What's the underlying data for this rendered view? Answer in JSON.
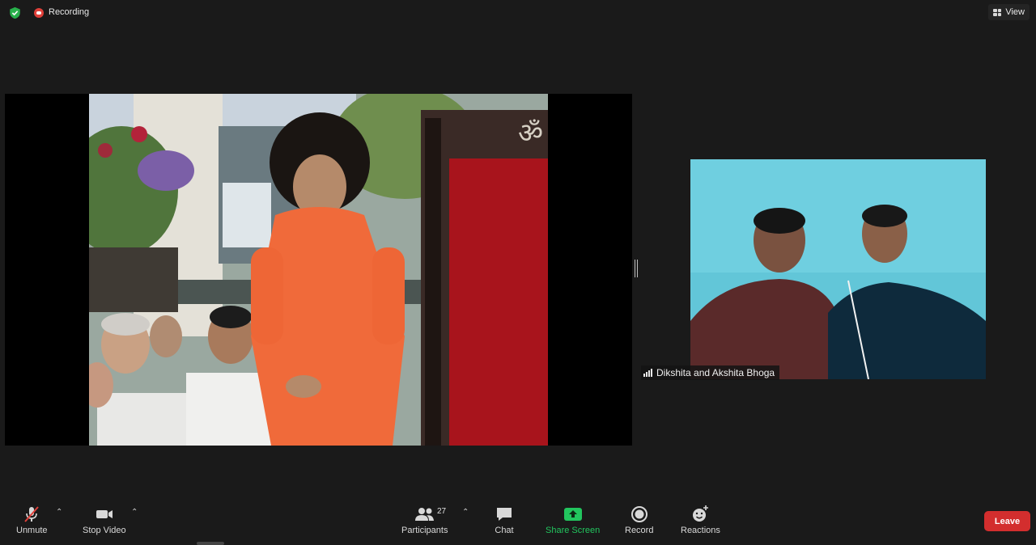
{
  "topbar": {
    "recording_label": "Recording",
    "view_label": "View"
  },
  "participant": {
    "name": "Dikshita and Akshita  Bhoga"
  },
  "toolbar": {
    "unmute_label": "Unmute",
    "stop_video_label": "Stop Video",
    "participants_label": "Participants",
    "participants_count": "27",
    "chat_label": "Chat",
    "share_screen_label": "Share Screen",
    "record_label": "Record",
    "reactions_label": "Reactions",
    "leave_label": "Leave"
  },
  "colors": {
    "background": "#1a1a1a",
    "recording": "#e0403a",
    "security_shield": "#28b04b",
    "share_screen": "#22c55e",
    "leave": "#d32e2e"
  }
}
